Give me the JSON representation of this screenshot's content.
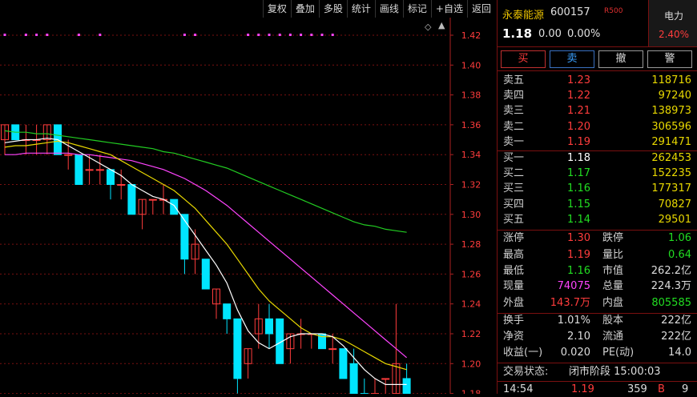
{
  "toolbar": {
    "items": [
      "复权",
      "叠加",
      "多股",
      "统计",
      "画线",
      "标记",
      "+自选",
      "返回"
    ]
  },
  "chart_data": {
    "type": "candlestick",
    "y_ticks": [
      "1.42",
      "1.40",
      "1.38",
      "1.36",
      "1.34",
      "1.32",
      "1.30",
      "1.28",
      "1.26",
      "1.24",
      "1.22",
      "1.20",
      "1.18"
    ],
    "ylim": [
      1.18,
      1.42
    ],
    "colors": {
      "up": "#ff3c3c",
      "down": "#00e5ff",
      "ma5": "#ffffff",
      "ma10": "#e8d800",
      "ma20": "#ff44ff",
      "ma60": "#22cc22"
    },
    "candles": [
      {
        "o": 1.35,
        "h": 1.36,
        "l": 1.34,
        "c": 1.36
      },
      {
        "o": 1.36,
        "h": 1.36,
        "l": 1.35,
        "c": 1.35
      },
      {
        "o": 1.35,
        "h": 1.36,
        "l": 1.34,
        "c": 1.35
      },
      {
        "o": 1.35,
        "h": 1.36,
        "l": 1.34,
        "c": 1.35
      },
      {
        "o": 1.35,
        "h": 1.36,
        "l": 1.34,
        "c": 1.36
      },
      {
        "o": 1.36,
        "h": 1.36,
        "l": 1.34,
        "c": 1.34
      },
      {
        "o": 1.34,
        "h": 1.35,
        "l": 1.33,
        "c": 1.34
      },
      {
        "o": 1.34,
        "h": 1.34,
        "l": 1.32,
        "c": 1.32
      },
      {
        "o": 1.33,
        "h": 1.34,
        "l": 1.32,
        "c": 1.33
      },
      {
        "o": 1.33,
        "h": 1.34,
        "l": 1.32,
        "c": 1.33
      },
      {
        "o": 1.33,
        "h": 1.33,
        "l": 1.31,
        "c": 1.32
      },
      {
        "o": 1.32,
        "h": 1.33,
        "l": 1.31,
        "c": 1.32
      },
      {
        "o": 1.32,
        "h": 1.32,
        "l": 1.3,
        "c": 1.3
      },
      {
        "o": 1.3,
        "h": 1.31,
        "l": 1.29,
        "c": 1.31
      },
      {
        "o": 1.31,
        "h": 1.31,
        "l": 1.3,
        "c": 1.31
      },
      {
        "o": 1.31,
        "h": 1.32,
        "l": 1.3,
        "c": 1.31
      },
      {
        "o": 1.31,
        "h": 1.31,
        "l": 1.3,
        "c": 1.3
      },
      {
        "o": 1.3,
        "h": 1.3,
        "l": 1.26,
        "c": 1.27
      },
      {
        "o": 1.27,
        "h": 1.29,
        "l": 1.26,
        "c": 1.28
      },
      {
        "o": 1.27,
        "h": 1.27,
        "l": 1.25,
        "c": 1.25
      },
      {
        "o": 1.24,
        "h": 1.25,
        "l": 1.23,
        "c": 1.25
      },
      {
        "o": 1.24,
        "h": 1.24,
        "l": 1.22,
        "c": 1.23
      },
      {
        "o": 1.23,
        "h": 1.23,
        "l": 1.18,
        "c": 1.19
      },
      {
        "o": 1.2,
        "h": 1.21,
        "l": 1.19,
        "c": 1.21
      },
      {
        "o": 1.22,
        "h": 1.24,
        "l": 1.21,
        "c": 1.23
      },
      {
        "o": 1.23,
        "h": 1.24,
        "l": 1.21,
        "c": 1.22
      },
      {
        "o": 1.23,
        "h": 1.23,
        "l": 1.2,
        "c": 1.2
      },
      {
        "o": 1.21,
        "h": 1.22,
        "l": 1.2,
        "c": 1.22
      },
      {
        "o": 1.22,
        "h": 1.23,
        "l": 1.21,
        "c": 1.22
      },
      {
        "o": 1.22,
        "h": 1.22,
        "l": 1.21,
        "c": 1.22
      },
      {
        "o": 1.22,
        "h": 1.22,
        "l": 1.21,
        "c": 1.21
      },
      {
        "o": 1.21,
        "h": 1.22,
        "l": 1.2,
        "c": 1.21
      },
      {
        "o": 1.21,
        "h": 1.21,
        "l": 1.19,
        "c": 1.19
      },
      {
        "o": 1.2,
        "h": 1.21,
        "l": 1.18,
        "c": 1.18
      },
      {
        "o": 1.18,
        "h": 1.19,
        "l": 1.17,
        "c": 1.17
      },
      {
        "o": 1.18,
        "h": 1.19,
        "l": 1.17,
        "c": 1.18
      },
      {
        "o": 1.19,
        "h": 1.19,
        "l": 1.18,
        "c": 1.19
      },
      {
        "o": 1.18,
        "h": 1.24,
        "l": 1.17,
        "c": 1.2
      },
      {
        "o": 1.19,
        "h": 1.2,
        "l": 1.17,
        "c": 1.18
      }
    ],
    "ma5": [
      1.348,
      1.349,
      1.35,
      1.35,
      1.351,
      1.35,
      1.346,
      1.342,
      1.338,
      1.334,
      1.33,
      1.326,
      1.32,
      1.316,
      1.312,
      1.31,
      1.306,
      1.296,
      1.286,
      1.276,
      1.266,
      1.254,
      1.236,
      1.222,
      1.214,
      1.21,
      1.214,
      1.218,
      1.22,
      1.22,
      1.22,
      1.218,
      1.212,
      1.204,
      1.196,
      1.19,
      1.186,
      1.186,
      1.186
    ],
    "ma10": [
      1.345,
      1.346,
      1.346,
      1.347,
      1.348,
      1.349,
      1.348,
      1.346,
      1.344,
      1.342,
      1.34,
      1.336,
      1.332,
      1.328,
      1.324,
      1.32,
      1.316,
      1.31,
      1.304,
      1.296,
      1.288,
      1.28,
      1.27,
      1.26,
      1.25,
      1.242,
      1.236,
      1.23,
      1.224,
      1.22,
      1.218,
      1.218,
      1.216,
      1.212,
      1.208,
      1.204,
      1.2,
      1.198,
      1.196
    ],
    "ma20": [
      1.34,
      1.34,
      1.341,
      1.341,
      1.341,
      1.341,
      1.341,
      1.34,
      1.34,
      1.339,
      1.338,
      1.337,
      1.336,
      1.334,
      1.332,
      1.33,
      1.327,
      1.324,
      1.32,
      1.316,
      1.311,
      1.306,
      1.3,
      1.294,
      1.288,
      1.282,
      1.276,
      1.27,
      1.264,
      1.258,
      1.252,
      1.246,
      1.24,
      1.234,
      1.228,
      1.222,
      1.216,
      1.21,
      1.204
    ],
    "ma60": [
      1.356,
      1.355,
      1.355,
      1.354,
      1.354,
      1.353,
      1.352,
      1.351,
      1.35,
      1.349,
      1.348,
      1.347,
      1.346,
      1.345,
      1.344,
      1.342,
      1.341,
      1.339,
      1.337,
      1.335,
      1.333,
      1.331,
      1.328,
      1.325,
      1.322,
      1.319,
      1.316,
      1.313,
      1.31,
      1.307,
      1.304,
      1.301,
      1.298,
      1.295,
      1.293,
      1.292,
      1.29,
      1.289,
      1.288
    ],
    "signal_markers": [
      0,
      2,
      3,
      4,
      7,
      9,
      17,
      18,
      23,
      24,
      25,
      26,
      27,
      28,
      29,
      30,
      31
    ]
  },
  "quote": {
    "name": "永泰能源",
    "code": "600157",
    "badge": "R500",
    "price": "1.18",
    "change": "0.00",
    "change_pct": "0.00%",
    "sector": {
      "name": "电力",
      "pct": "2.40%"
    }
  },
  "buttons": {
    "buy": "买",
    "sell": "卖",
    "cancel": "撤",
    "alert": "警"
  },
  "asks": [
    {
      "label": "卖五",
      "price": "1.23",
      "volume": "118716"
    },
    {
      "label": "卖四",
      "price": "1.22",
      "volume": "97240"
    },
    {
      "label": "卖三",
      "price": "1.21",
      "volume": "138973"
    },
    {
      "label": "卖二",
      "price": "1.20",
      "volume": "306596"
    },
    {
      "label": "卖一",
      "price": "1.19",
      "volume": "291471"
    }
  ],
  "bids": [
    {
      "label": "买一",
      "price": "1.18",
      "volume": "262453"
    },
    {
      "label": "买二",
      "price": "1.17",
      "volume": "152235"
    },
    {
      "label": "买三",
      "price": "1.16",
      "volume": "177317"
    },
    {
      "label": "买四",
      "price": "1.15",
      "volume": "70827"
    },
    {
      "label": "买五",
      "price": "1.14",
      "volume": "29501"
    }
  ],
  "stats": {
    "limit_up_label": "涨停",
    "limit_up": "1.30",
    "limit_down_label": "跌停",
    "limit_down": "1.06",
    "high_label": "最高",
    "high": "1.19",
    "vol_ratio_label": "量比",
    "vol_ratio": "0.64",
    "low_label": "最低",
    "low": "1.16",
    "mcap_label": "市值",
    "mcap": "262.2亿",
    "cur_vol_label": "现量",
    "cur_vol": "74075",
    "total_vol_label": "总量",
    "total_vol": "224.3万",
    "outer_label": "外盘",
    "outer": "143.7万",
    "inner_label": "内盘",
    "inner": "805585",
    "turnover_label": "换手",
    "turnover": "1.01%",
    "shares_label": "股本",
    "shares": "222亿",
    "nav_label": "净资",
    "nav": "2.10",
    "float_label": "流通",
    "float": "222亿",
    "eps_label": "收益(一)",
    "eps": "0.020",
    "pe_label": "PE(动)",
    "pe": "14.0"
  },
  "status": {
    "label": "交易状态:",
    "value": "闭市阶段 15:00:03"
  },
  "tick": {
    "time": "14:54",
    "price": "1.19",
    "volume": "359",
    "side": "B",
    "count": "9"
  }
}
